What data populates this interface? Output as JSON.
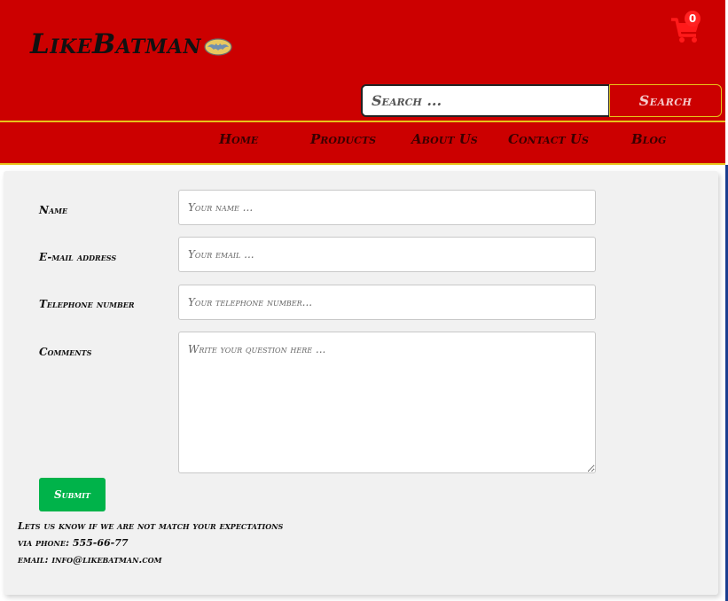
{
  "site": {
    "logo_text": "LikeBatman"
  },
  "cart": {
    "count": "0",
    "icon": "shopping-cart-icon"
  },
  "search": {
    "placeholder": "Search ...",
    "button_label": "Search"
  },
  "nav": {
    "items": [
      {
        "label": "Home"
      },
      {
        "label": "Products"
      },
      {
        "label": "About Us"
      },
      {
        "label": "Contact Us"
      },
      {
        "label": "Blog"
      }
    ]
  },
  "form": {
    "name_label": "Name",
    "name_placeholder": "Your name ...",
    "email_label": "E-mail address",
    "email_placeholder": "Your email ...",
    "phone_label": "Telephone number",
    "phone_placeholder": "Your telephone number...",
    "comments_label": "Comments",
    "comments_placeholder": "Write your question here ...",
    "submit_label": "Submit"
  },
  "footer": {
    "line1": "Lets us know if we are not match your expectations",
    "line2": "via phone: 555-66-77",
    "line3": "email: info@likebatman.com"
  },
  "colors": {
    "header_red": "#cc0000",
    "accent_yellow": "#e8c21a",
    "submit_green": "#00b34a",
    "content_bg": "#f1f1f1"
  }
}
